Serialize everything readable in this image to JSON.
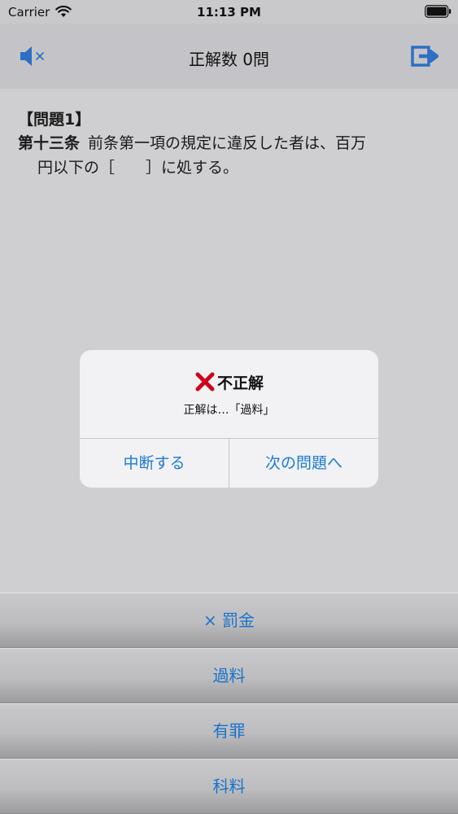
{
  "status_bar": {
    "carrier": "Carrier",
    "time": "11:13 PM"
  },
  "nav": {
    "title": "正解数 0問",
    "left_icon": "speaker-muted-icon",
    "right_icon": "exit-icon"
  },
  "question": {
    "number": "【問題1】",
    "article": "第十三条",
    "line1": "前条第一項の規定に違反した者は、百万",
    "line2": "円以下の［　　］に処する。"
  },
  "alert": {
    "title": "不正解",
    "message": "正解は…「過料」",
    "buttons": {
      "left": "中断する",
      "right": "次の問題へ"
    }
  },
  "answers": [
    {
      "label": "× 罰金"
    },
    {
      "label": "過料"
    },
    {
      "label": "有罪"
    },
    {
      "label": "科料"
    }
  ],
  "colors": {
    "accent": "#1a7ad6",
    "wrong_mark": "#d0021b"
  }
}
